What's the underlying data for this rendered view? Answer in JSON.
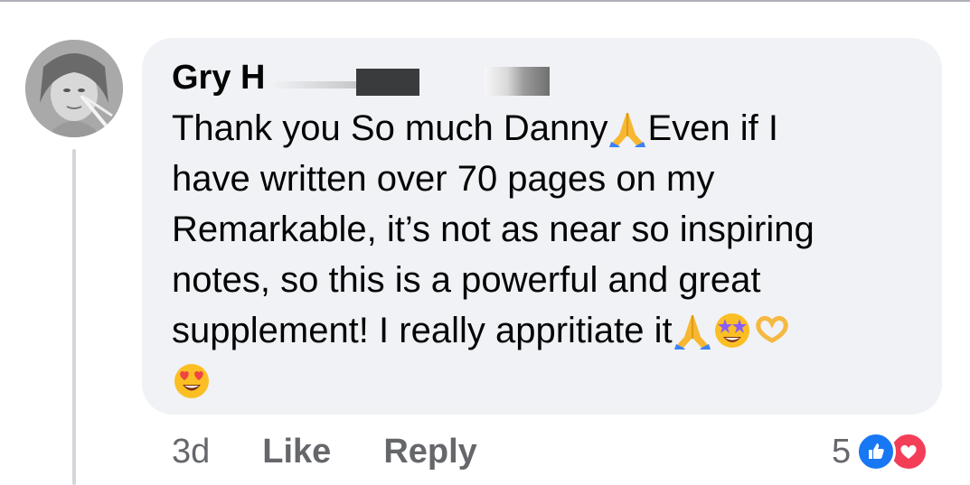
{
  "comment": {
    "author": "Gry H",
    "text_lines": [
      "Thank you So much Danny",
      "Even if I",
      "have written over 70 pages on my",
      "Remarkable, it’s not as near so inspiring",
      "notes, so this is a powerful and great",
      "supplement! I really appritiate  it"
    ],
    "emojis": [
      "folded-hands",
      "folded-hands",
      "star-struck",
      "heart-hands",
      "heart-eyes"
    ]
  },
  "footer": {
    "age": "3d",
    "like_label": "Like",
    "reply_label": "Reply",
    "reaction_count": "5",
    "reactions": [
      "like",
      "love"
    ]
  },
  "colors": {
    "bubble": "#f0f2f5",
    "text": "#050505",
    "secondary_text": "#65676b",
    "like_blue": "#1877f2",
    "love_red": "#f33e58"
  }
}
